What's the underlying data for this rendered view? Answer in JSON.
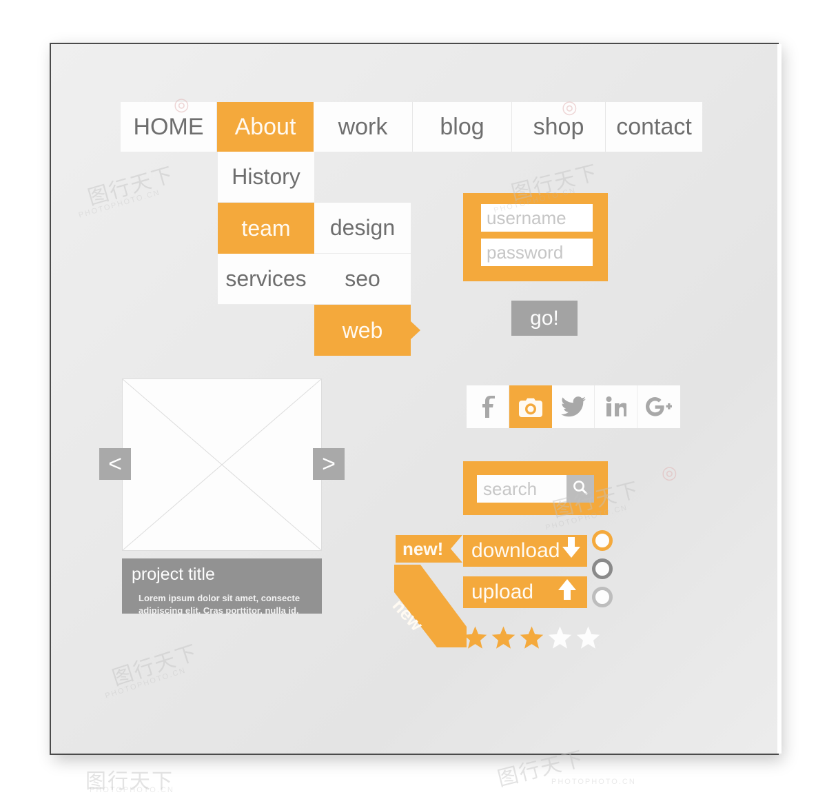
{
  "theme": {
    "accent": "#F4A93C",
    "accent_text": "#FFFAF2",
    "gray_text": "#6E6E6E",
    "panel_gray": "#929292",
    "button_gray": "#A3A3A3",
    "background": "#E9E9E9",
    "white": "#FDFDFD"
  },
  "nav": {
    "items": [
      {
        "label": "HOME",
        "active": false
      },
      {
        "label": "About",
        "active": true
      },
      {
        "label": "work",
        "active": false
      },
      {
        "label": "blog",
        "active": false
      },
      {
        "label": "shop",
        "active": false
      },
      {
        "label": "contact",
        "active": false
      }
    ]
  },
  "dropdown": {
    "items": [
      {
        "label": "History",
        "active": false
      },
      {
        "label": "team",
        "active": true
      },
      {
        "label": "services",
        "active": false
      }
    ],
    "submenu": [
      {
        "label": "design",
        "active": false
      },
      {
        "label": "seo",
        "active": false
      },
      {
        "label": "web",
        "active": true
      }
    ]
  },
  "login": {
    "username_placeholder": "username",
    "password_placeholder": "password",
    "go_label": "go!"
  },
  "social": {
    "items": [
      {
        "name": "facebook",
        "glyph": "f",
        "active": false
      },
      {
        "name": "instagram",
        "glyph": "camera",
        "active": true
      },
      {
        "name": "twitter",
        "glyph": "bird",
        "active": false
      },
      {
        "name": "linkedin",
        "glyph": "in",
        "active": false
      },
      {
        "name": "googleplus",
        "glyph": "G+",
        "active": false
      }
    ]
  },
  "search": {
    "placeholder": "search",
    "button_icon": "search-icon"
  },
  "carousel": {
    "prev_label": "<",
    "next_label": ">",
    "placeholder_icon": "image-placeholder-x"
  },
  "project_card": {
    "title": "project title",
    "line1": "Lorem ipsum dolor sit amet, consecte",
    "line2": "adipiscing elit. Cras porttitor, nulla id."
  },
  "ribbons": {
    "flag_label": "new!",
    "corner_label": "new"
  },
  "actions": {
    "download_label": "download",
    "download_icon": "arrow-down-icon",
    "upload_label": "upload",
    "upload_icon": "arrow-up-icon"
  },
  "rating": {
    "filled": 3,
    "total": 5,
    "filled_color": "#F4A93C",
    "empty_color": "#FDFDFD"
  },
  "radios": {
    "items": [
      {
        "state": "selected",
        "color": "#F4A93C"
      },
      {
        "state": "hover",
        "color": "#8A8A8A"
      },
      {
        "state": "default",
        "color": "#BDBDBD"
      }
    ]
  },
  "watermark": {
    "site": "PHOTOPHOTO.CN",
    "cjk": "图行天下"
  }
}
